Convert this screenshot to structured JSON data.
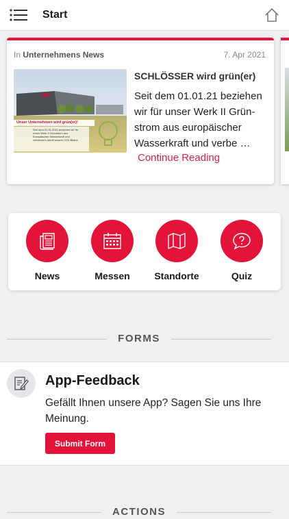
{
  "header": {
    "title": "Start",
    "menu_icon": "menu-icon",
    "home_icon": "home-icon"
  },
  "news_card": {
    "category_prefix": "In",
    "category": "Unternehmens News",
    "date": "7. Apr 2021",
    "headline": "SCHLÖSSER wird grün(er)",
    "excerpt": "Seit dem 01.01.21 beziehen wir für unser Werk II Grün­strom aus europäischer Wasserkraft und verbe …",
    "more_label": "Continue Reading",
    "thumbnail": {
      "banner": "Unser Unternehmen wird grün(er)!",
      "caption_lines": [
        "Seit dem 01.01.2021 beziehen wir für",
        "unser Werk II Grünstrom aus",
        "Europäischer Wasserkraft und",
        "verbessern damit unsere CO2-Bilanz."
      ]
    }
  },
  "quick_links": [
    {
      "label": "News",
      "icon": "newspaper-icon"
    },
    {
      "label": "Messen",
      "icon": "calendar-icon"
    },
    {
      "label": "Standorte",
      "icon": "map-icon"
    },
    {
      "label": "Quiz",
      "icon": "question-bubble-icon"
    }
  ],
  "sections": {
    "forms": "FORMS",
    "actions": "ACTIONS"
  },
  "feedback": {
    "title": "App-Feedback",
    "description": "Gefällt Ihnen unsere App? Sagen Sie uns Ihre Meinung.",
    "button_label": "Submit Form",
    "icon": "edit-form-icon"
  },
  "colors": {
    "accent": "#e3133a",
    "link": "#d61f46",
    "background": "#f0f0f2"
  }
}
